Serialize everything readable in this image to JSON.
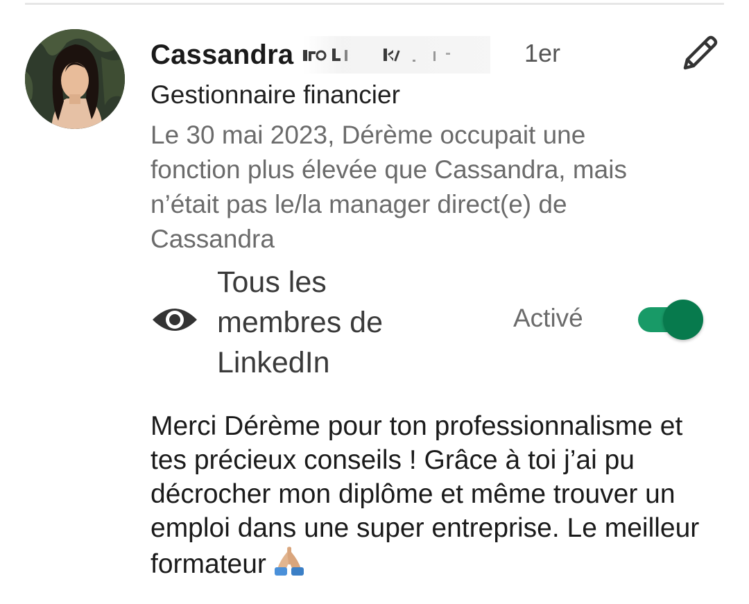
{
  "profile": {
    "name": "Cassandra",
    "connection_degree": "1er",
    "headline": "Gestionnaire financier",
    "relationship": "Le 30 mai 2023, Dérème occupait une fonction plus élevée que Cassandra, mais n’était pas le/la manager direct(e) de Cassandra"
  },
  "visibility": {
    "icon": "eye-icon",
    "label": "Tous les membres de LinkedIn",
    "status": "Activé",
    "toggle_on": true
  },
  "recommendation": {
    "text": "Merci Dérème pour ton professionnalisme et tes précieux conseils ! Grâce à toi j’ai pu décrocher mon diplôme et même trouver un emploi dans une super entreprise. Le meilleur formateur",
    "emoji_icon": "folded-hands-icon"
  },
  "icons": {
    "edit": "pencil-icon"
  },
  "colors": {
    "toggle_track": "#189a67",
    "toggle_thumb": "#077a4d",
    "secondary_text": "#6b6b6b"
  }
}
